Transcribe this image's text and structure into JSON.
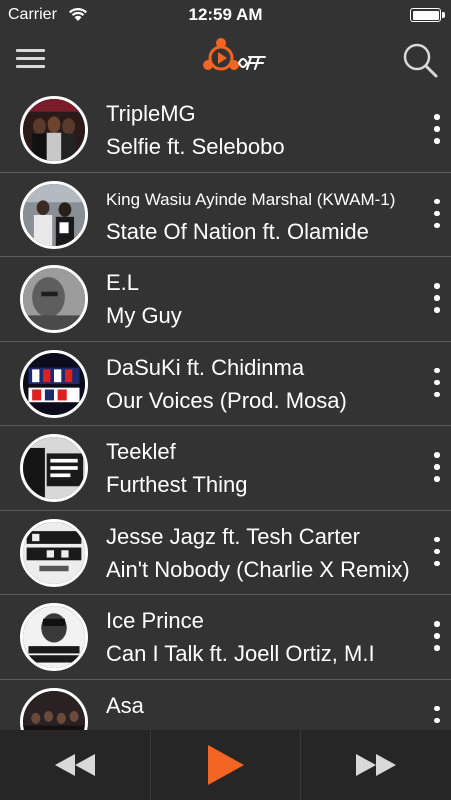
{
  "status_bar": {
    "carrier": "Carrier",
    "time": "12:59 AM",
    "battery_level": 1.0
  },
  "nav": {
    "menu_icon": "hamburger-menu-icon",
    "logo_icon": "app-logo-icon",
    "search_icon": "search-icon"
  },
  "colors": {
    "background": "#333333",
    "player_bar": "#262626",
    "accent": "#f26522",
    "divider": "#5d5d5d",
    "text": "#ffffff"
  },
  "tracks": [
    {
      "artist": "TripleMG",
      "title": "Selfie ft. Selebobo"
    },
    {
      "artist": "King Wasiu Ayinde Marshal (KWAM-1)",
      "title": "State Of Nation ft. Olamide"
    },
    {
      "artist": "E.L",
      "title": "My Guy"
    },
    {
      "artist": "DaSuKi ft. Chidinma",
      "title": "Our Voices (Prod. Mosa)"
    },
    {
      "artist": "Teeklef",
      "title": "Furthest Thing"
    },
    {
      "artist": "Jesse Jagz ft. Tesh Carter",
      "title": "Ain't Nobody (Charlie X Remix)"
    },
    {
      "artist": "Ice Prince",
      "title": "Can I Talk ft. Joell Ortiz, M.I"
    },
    {
      "artist": "Asa",
      "title": ""
    }
  ],
  "player": {
    "prev_icon": "rewind-icon",
    "play_icon": "play-icon",
    "next_icon": "fast-forward-icon"
  }
}
